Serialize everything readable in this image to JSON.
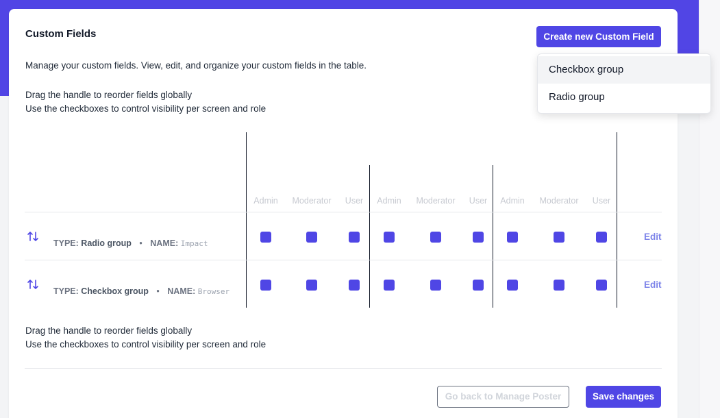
{
  "page": {
    "title": "Custom Fields",
    "create_button": "Create new Custom Field",
    "description": "Manage your custom fields. View, edit, and organize your custom fields in the table.",
    "hint_line1": "Drag the handle to reorder fields globally",
    "hint_line2": "Use the checkboxes to control visibility per screen and role"
  },
  "table": {
    "column_headers": [
      "Admin",
      "Moderator",
      "User",
      "Admin",
      "Moderator",
      "User",
      "Admin",
      "Moderator",
      "User"
    ],
    "rows": [
      {
        "type_label": "TYPE:",
        "type_value": "Radio group",
        "separator": "•",
        "name_label": "NAME:",
        "name_value": "Impact",
        "checked": [
          true,
          true,
          true,
          true,
          true,
          true,
          true,
          true,
          true
        ],
        "edit_label": "Edit"
      },
      {
        "type_label": "TYPE:",
        "type_value": "Checkbox group",
        "separator": "•",
        "name_label": "NAME:",
        "name_value": "Browser",
        "checked": [
          true,
          true,
          true,
          true,
          true,
          true,
          true,
          true,
          true
        ],
        "edit_label": "Edit"
      }
    ]
  },
  "footer": {
    "back_button": "Go back to Manage Poster",
    "save_button": "Save changes"
  },
  "dropdown": {
    "items": [
      "Checkbox group",
      "Radio group"
    ],
    "highlighted_index": 0
  },
  "colors": {
    "accent": "#4f46e5",
    "header_band": "#5145e5",
    "edit_link": "#7c83e9"
  },
  "icons": {
    "drag_handle": "arrows-up-down-icon"
  }
}
